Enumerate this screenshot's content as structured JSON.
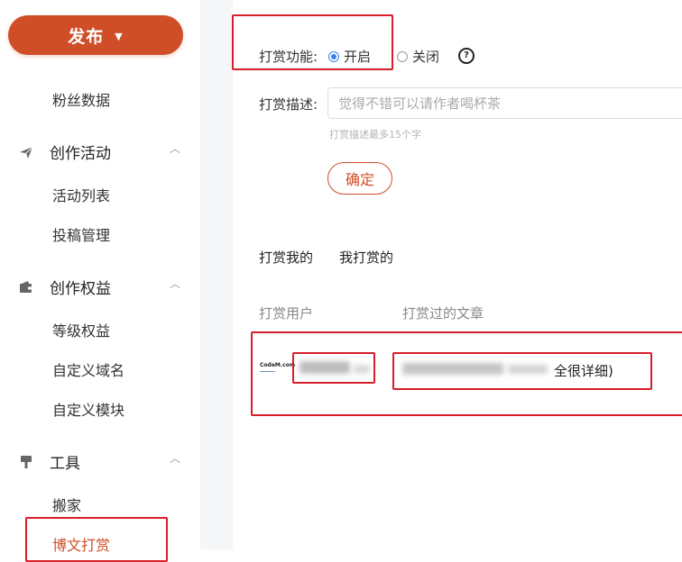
{
  "sidebar": {
    "publish_label": "发布",
    "fans_data": "粉丝数据",
    "groups": [
      {
        "title": "创作活动",
        "icon": "paper-plane-icon",
        "items": [
          "活动列表",
          "投稿管理"
        ]
      },
      {
        "title": "创作权益",
        "icon": "wallet-icon",
        "items": [
          "等级权益",
          "自定义域名",
          "自定义模块"
        ]
      },
      {
        "title": "工具",
        "icon": "brush-icon",
        "items": [
          "搬家",
          "博文打赏"
        ]
      }
    ],
    "active_item": "博文打赏"
  },
  "settings": {
    "reward_label": "打赏功能:",
    "on_label": "开启",
    "off_label": "关闭",
    "selected": "开启",
    "desc_label": "打赏描述:",
    "desc_placeholder": "觉得不错可以请作者喝杯茶",
    "desc_hint": "打赏描述最多15个字",
    "confirm_label": "确定"
  },
  "tabs": [
    "打赏我的",
    "我打赏的"
  ],
  "table": {
    "headers": [
      "打赏用户",
      "打赏过的文章"
    ],
    "rows": [
      {
        "avatar_text": "CodeM.com",
        "user": "[blurred]",
        "article_tail": "全很详细)"
      }
    ]
  },
  "colors": {
    "accent": "#cf4e27",
    "highlight": "#d81e2a",
    "radio": "#3b7ff0"
  }
}
